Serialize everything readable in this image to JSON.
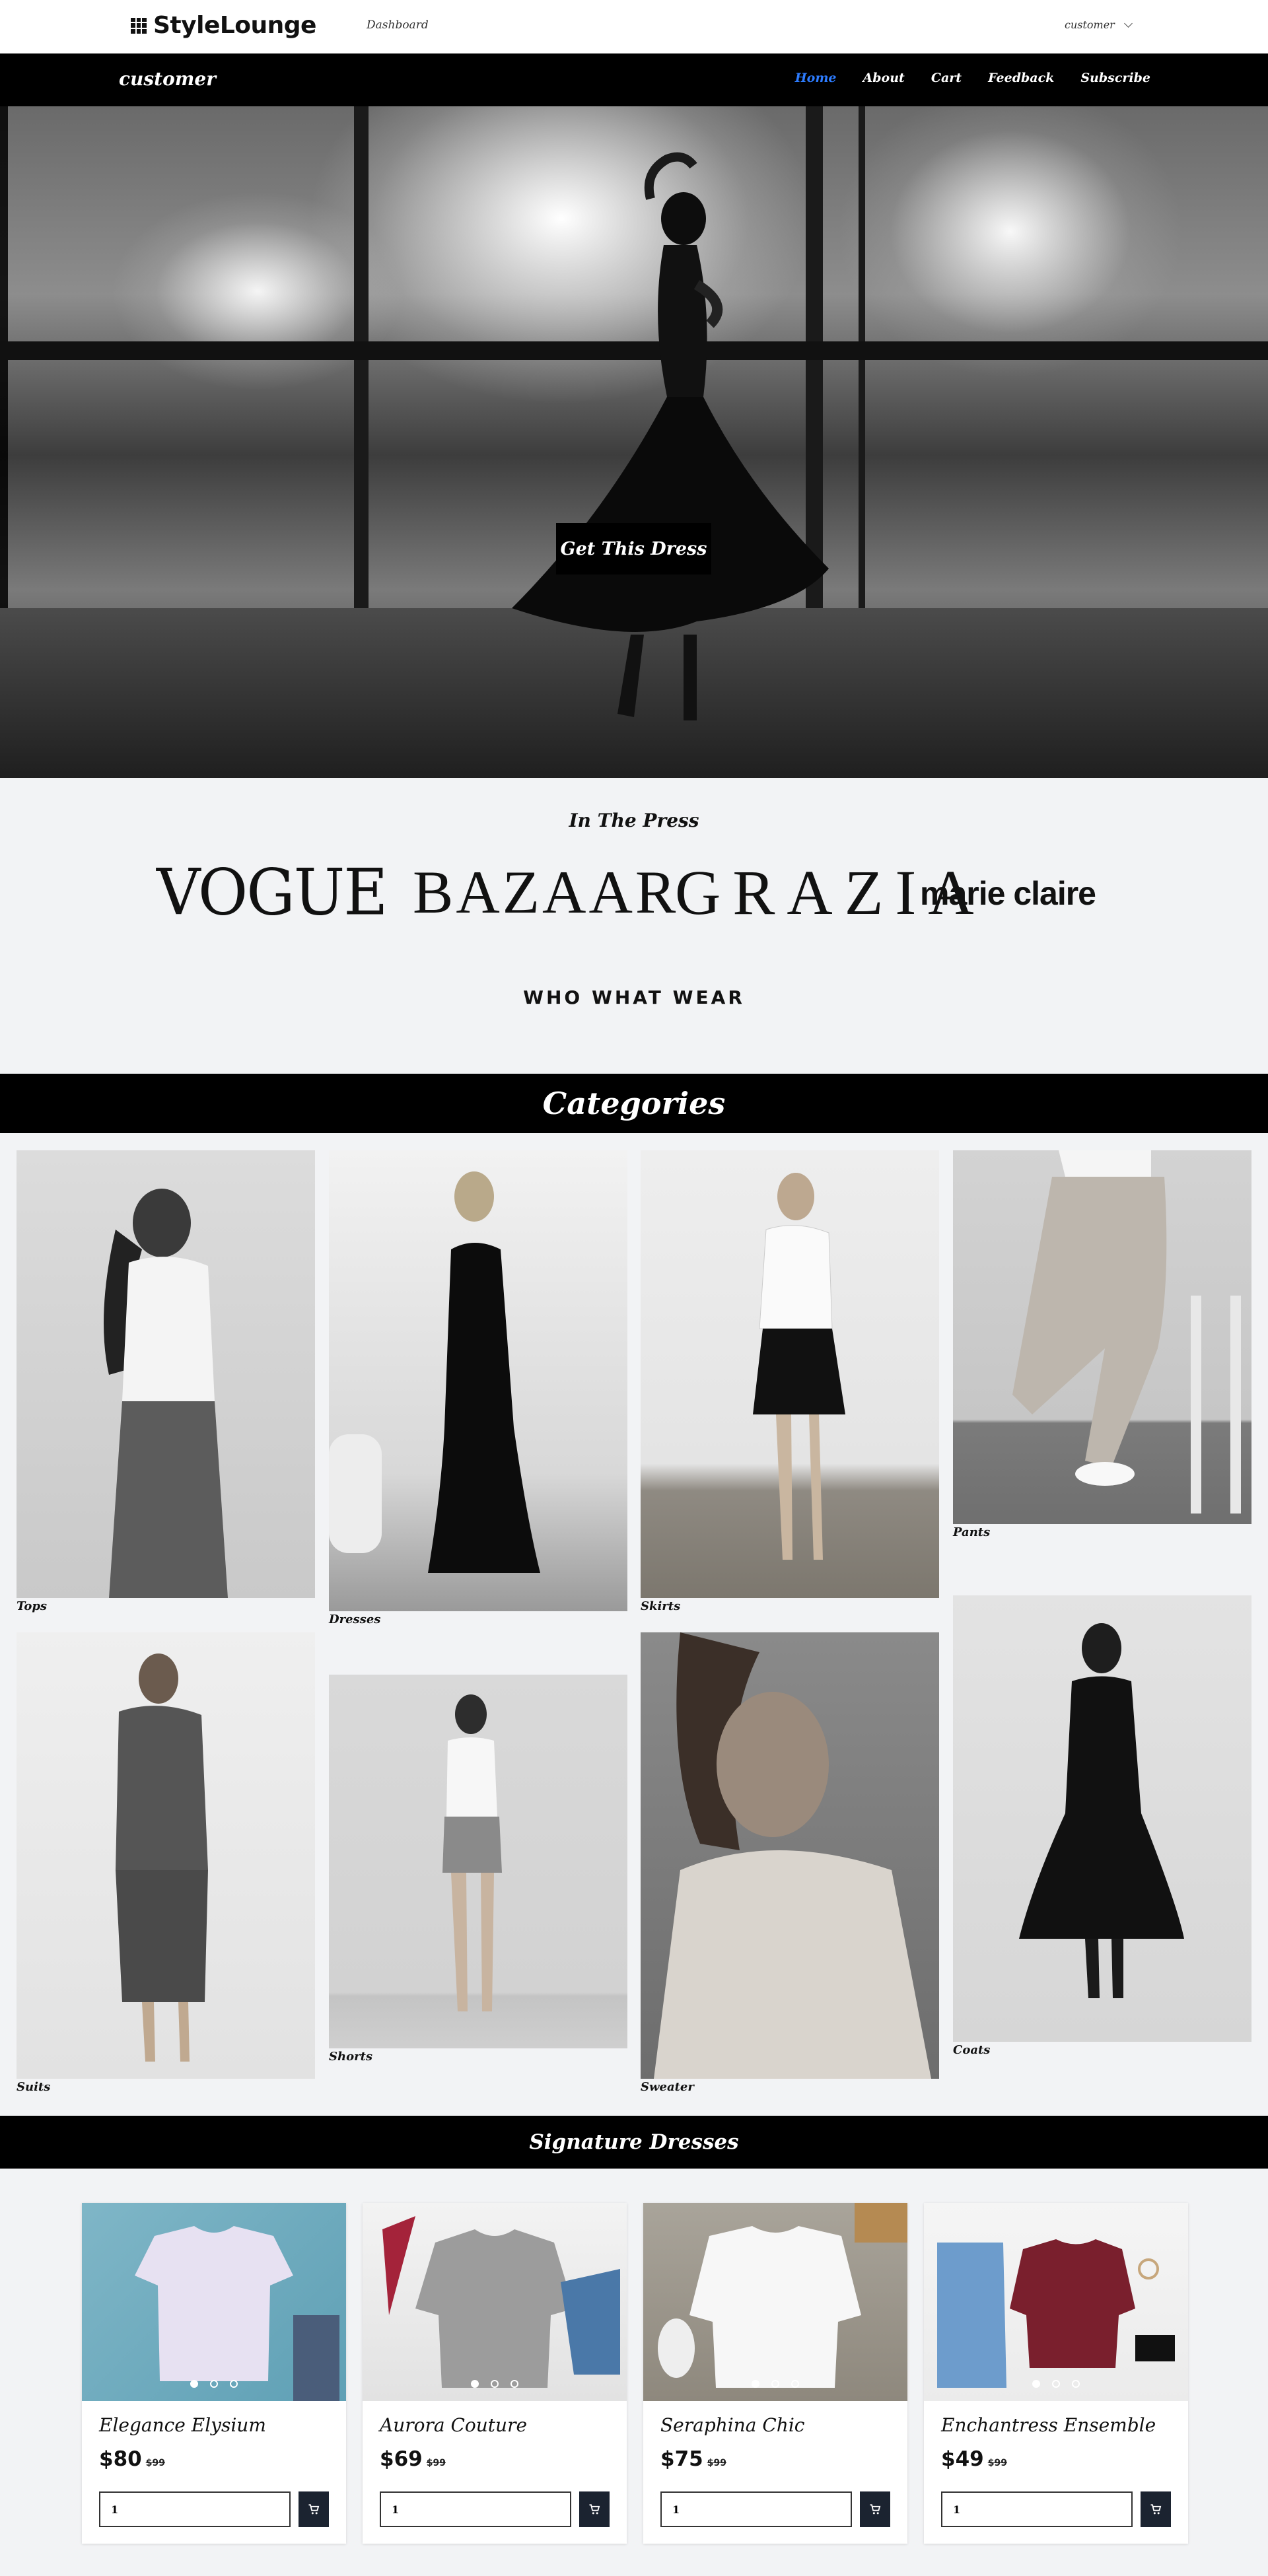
{
  "topbar": {
    "brand": "StyleLounge",
    "dashboard_link": "Dashboard",
    "user": "customer"
  },
  "nav": {
    "brand": "customer",
    "links": [
      "Home",
      "About",
      "Cart",
      "Feedback",
      "Subscribe"
    ],
    "active": "Home"
  },
  "hero": {
    "cta": "Get This Dress"
  },
  "press": {
    "title": "In The Press",
    "logos": [
      "VOGUE",
      "BAZAAR",
      "GRAZIA",
      "marie claire",
      "WHO WHAT WEAR"
    ]
  },
  "categories": {
    "title": "Categories",
    "items": [
      "Tops",
      "Dresses",
      "Skirts",
      "Pants",
      "Suits",
      "Shorts",
      "Sweater",
      "Coats"
    ]
  },
  "signature": {
    "title": "Signature Dresses",
    "products": [
      {
        "name": "Elegance Elysium",
        "price": "$80",
        "old_price": "$99",
        "qty": "1"
      },
      {
        "name": "Aurora Couture",
        "price": "$69",
        "old_price": "$99",
        "qty": "1"
      },
      {
        "name": "Seraphina Chic",
        "price": "$75",
        "old_price": "$99",
        "qty": "1"
      },
      {
        "name": "Enchantress Ensemble",
        "price": "$49",
        "old_price": "$99",
        "qty": "1"
      }
    ]
  },
  "colors": {
    "nav_bg": "#000000",
    "active_link": "#2d7cff",
    "page_bg": "#f2f3f5",
    "cart_button": "#1b2330"
  },
  "icons": [
    "grid-logo-icon",
    "chevron-down-icon",
    "cart-icon"
  ]
}
